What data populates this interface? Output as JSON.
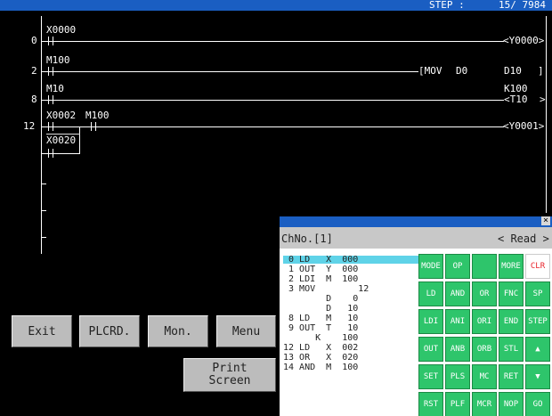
{
  "step": {
    "label": "STEP :",
    "value": "15/ 7984"
  },
  "ladder": {
    "step_numbers": [
      "0",
      "2",
      "8",
      "12"
    ],
    "devices": [
      "X0000",
      "M100",
      "M10",
      "X0002",
      "M100",
      "X0020"
    ],
    "outputs": [
      "<Y0000>",
      "[MOV",
      "D0",
      "D10",
      "]",
      "K100",
      "<T10",
      ">",
      "<Y0001>"
    ]
  },
  "buttons": {
    "exit": "Exit",
    "plcrd": "PLCRD.",
    "mon": "Mon.",
    "menu": "Menu",
    "print": "Print\nScreen"
  },
  "panel": {
    "close": "×",
    "channel": "ChNo.[1]",
    "mode": "< Read >",
    "list": [
      " 0 LD   X  000",
      " 1 OUT  Y  000",
      " 2 LDI  M  100",
      " 3 MOV        12",
      "        D    0",
      "        D   10",
      " 8 LD   M   10",
      " 9 OUT  T   10",
      "      K    100",
      "12 LD   X  002",
      "13 OR   X  020",
      "14 AND  M  100"
    ],
    "keys": [
      [
        "MODE",
        "OP",
        "",
        "MORE",
        "CLR"
      ],
      [
        "LD",
        "AND",
        "OR",
        "FNC",
        "SP"
      ],
      [
        "LDI",
        "ANI",
        "ORI",
        "END",
        "STEP"
      ],
      [
        "OUT",
        "ANB",
        "ORB",
        "STL",
        "▲"
      ],
      [
        "SET",
        "PLS",
        "MC",
        "RET",
        "▼"
      ],
      [
        "RST",
        "PLF",
        "MCR",
        "NOP",
        "GO"
      ]
    ],
    "key_color": "#2ec56b",
    "clr_color": "#e8222a",
    "highlight_color": "#5fd3e8"
  }
}
